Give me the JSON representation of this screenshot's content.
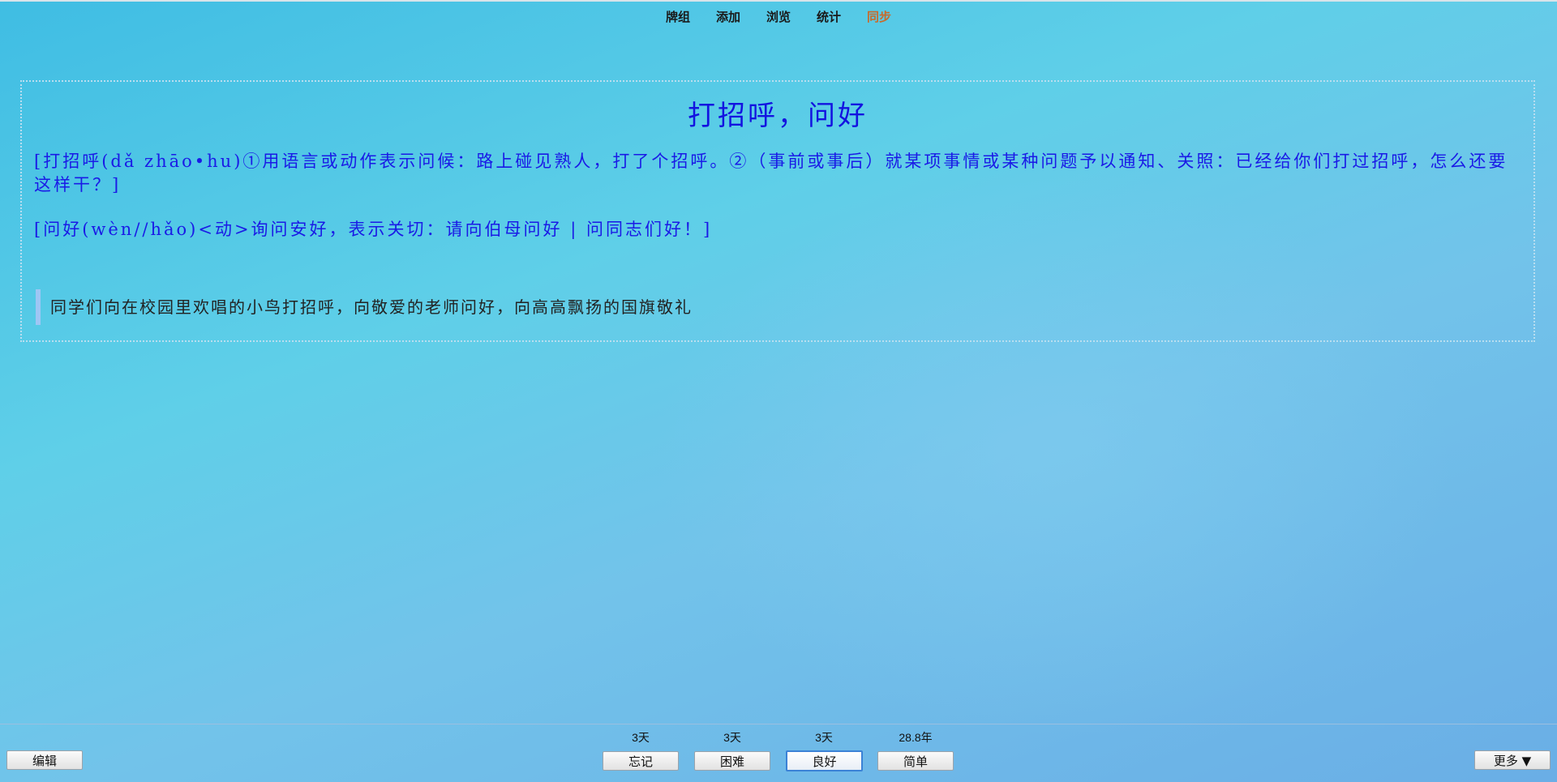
{
  "nav": {
    "decks": "牌组",
    "add": "添加",
    "browse": "浏览",
    "stats": "统计",
    "sync": "同步"
  },
  "card": {
    "title": "打招呼，问好",
    "definition_1": "[打招呼(dǎ zhāo•hu)①用语言或动作表示问候：路上碰见熟人，打了个招呼。②（事前或事后）就某项事情或某种问题予以通知、关照：已经给你们打过招呼，怎么还要这样干？]",
    "definition_2": "[问好(wèn//hǎo)<动>询问安好，表示关切：请向伯母问好 | 问同志们好！]",
    "example": "同学们向在校园里欢唱的小鸟打招呼，向敬爱的老师问好，向高高飘扬的国旗敬礼"
  },
  "bottom_bar": {
    "edit": "编辑",
    "more": "更多 ▼",
    "answers": [
      {
        "time": "3天",
        "label": "忘记"
      },
      {
        "time": "3天",
        "label": "困难"
      },
      {
        "time": "3天",
        "label": "良好"
      },
      {
        "time": "28.8年",
        "label": "简单"
      }
    ]
  },
  "colors": {
    "title": "#1313e0",
    "definition": "#1a1ae6",
    "sync_active": "#c86a2a"
  }
}
